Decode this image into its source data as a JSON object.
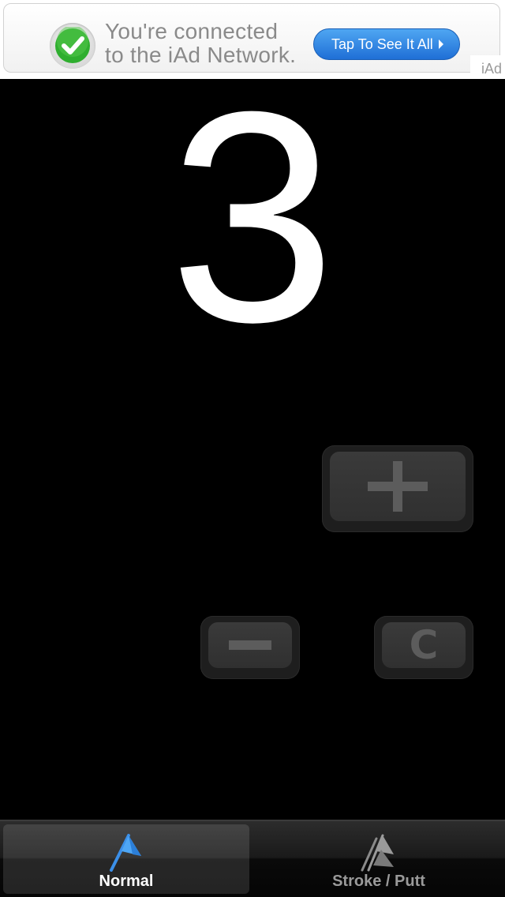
{
  "ad": {
    "line1": "You're connected",
    "line2": "to the iAd Network.",
    "cta_label": "Tap To See It All",
    "network_label": "iAd",
    "cta_color": "#2a84e6",
    "check_color": "#2fae2f"
  },
  "score": {
    "value": "3"
  },
  "controls": {
    "increment_icon": "plus-icon",
    "decrement_icon": "minus-icon",
    "clear_label": "C"
  },
  "tabs": [
    {
      "label": "Normal",
      "icon": "flag-icon",
      "selected": true
    },
    {
      "label": "Stroke / Putt",
      "icon": "double-flag-icon",
      "selected": false
    }
  ]
}
